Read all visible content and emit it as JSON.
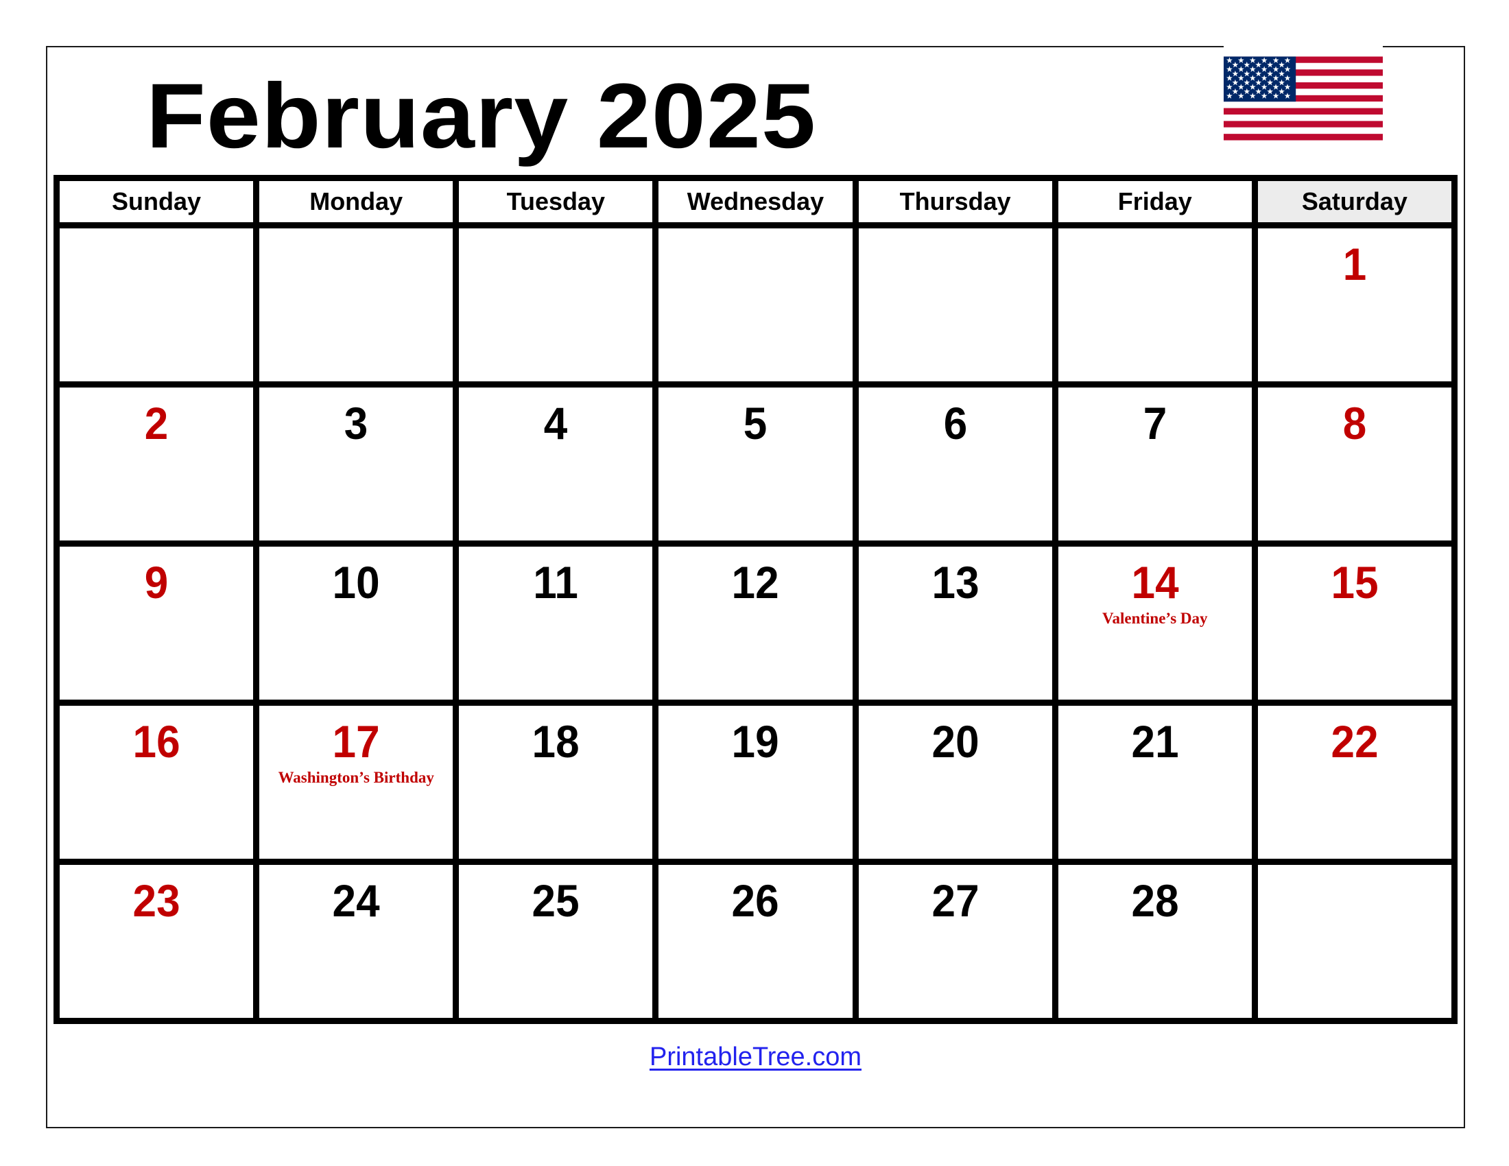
{
  "document": {
    "title": "February 2025",
    "month": "February",
    "year": "2025"
  },
  "flag": {
    "name": "united-states-flag",
    "colors": {
      "red": "#BF0A30",
      "white": "#FFFFFF",
      "blue": "#002868"
    },
    "stripes": 13,
    "stars": 50
  },
  "colors": {
    "weekend_red": "#c00000",
    "weekday_black": "#000000",
    "saturday_header_bg": "#ececec",
    "grid_line": "#000000",
    "link_blue": "#2222ee"
  },
  "weekdays": [
    {
      "label": "Sunday",
      "highlight": false
    },
    {
      "label": "Monday",
      "highlight": false
    },
    {
      "label": "Tuesday",
      "highlight": false
    },
    {
      "label": "Wednesday",
      "highlight": false
    },
    {
      "label": "Thursday",
      "highlight": false
    },
    {
      "label": "Friday",
      "highlight": false
    },
    {
      "label": "Saturday",
      "highlight": true
    }
  ],
  "weeks": [
    [
      {
        "day": "",
        "red": false,
        "event": ""
      },
      {
        "day": "",
        "red": false,
        "event": ""
      },
      {
        "day": "",
        "red": false,
        "event": ""
      },
      {
        "day": "",
        "red": false,
        "event": ""
      },
      {
        "day": "",
        "red": false,
        "event": ""
      },
      {
        "day": "",
        "red": false,
        "event": ""
      },
      {
        "day": "1",
        "red": true,
        "event": ""
      }
    ],
    [
      {
        "day": "2",
        "red": true,
        "event": ""
      },
      {
        "day": "3",
        "red": false,
        "event": ""
      },
      {
        "day": "4",
        "red": false,
        "event": ""
      },
      {
        "day": "5",
        "red": false,
        "event": ""
      },
      {
        "day": "6",
        "red": false,
        "event": ""
      },
      {
        "day": "7",
        "red": false,
        "event": ""
      },
      {
        "day": "8",
        "red": true,
        "event": ""
      }
    ],
    [
      {
        "day": "9",
        "red": true,
        "event": ""
      },
      {
        "day": "10",
        "red": false,
        "event": ""
      },
      {
        "day": "11",
        "red": false,
        "event": ""
      },
      {
        "day": "12",
        "red": false,
        "event": ""
      },
      {
        "day": "13",
        "red": false,
        "event": ""
      },
      {
        "day": "14",
        "red": true,
        "event": "Valentine’s Day"
      },
      {
        "day": "15",
        "red": true,
        "event": ""
      }
    ],
    [
      {
        "day": "16",
        "red": true,
        "event": ""
      },
      {
        "day": "17",
        "red": true,
        "event": "Washington’s Birthday"
      },
      {
        "day": "18",
        "red": false,
        "event": ""
      },
      {
        "day": "19",
        "red": false,
        "event": ""
      },
      {
        "day": "20",
        "red": false,
        "event": ""
      },
      {
        "day": "21",
        "red": false,
        "event": ""
      },
      {
        "day": "22",
        "red": true,
        "event": ""
      }
    ],
    [
      {
        "day": "23",
        "red": true,
        "event": ""
      },
      {
        "day": "24",
        "red": false,
        "event": ""
      },
      {
        "day": "25",
        "red": false,
        "event": ""
      },
      {
        "day": "26",
        "red": false,
        "event": ""
      },
      {
        "day": "27",
        "red": false,
        "event": ""
      },
      {
        "day": "28",
        "red": false,
        "event": ""
      },
      {
        "day": "",
        "red": false,
        "event": ""
      }
    ]
  ],
  "footer": {
    "link_text": "PrintableTree.com"
  }
}
